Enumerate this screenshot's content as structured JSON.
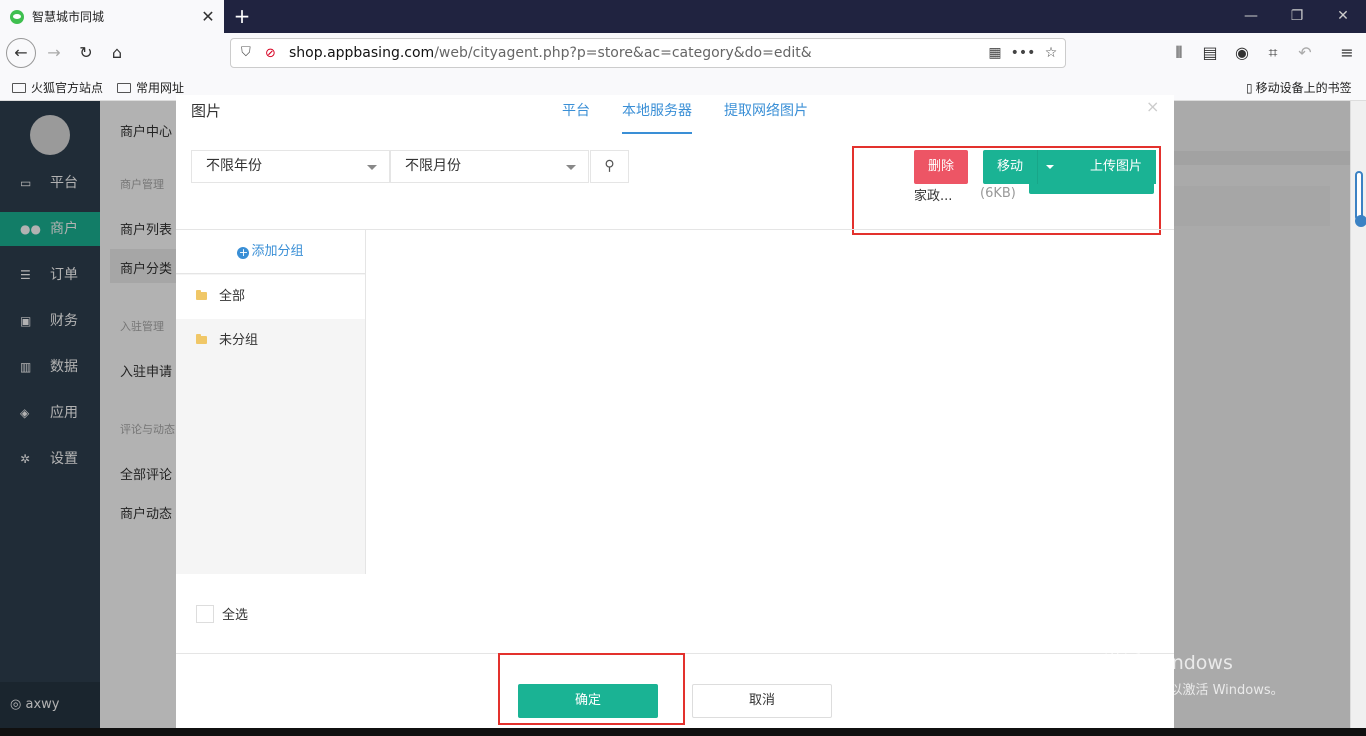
{
  "browser": {
    "tab_title": "智慧城市同城",
    "tab_close": "✕",
    "new_tab": "+",
    "url_domain": "shop.appbasing.com",
    "url_path": "/web/cityagent.php?p=store&ac=category&do=edit&",
    "bookmarks": [
      "火狐官方站点",
      "常用网址"
    ],
    "mobile_bookmarks": "移动设备上的书签"
  },
  "sidebar": {
    "items": [
      {
        "label": "平台",
        "icon": "monitor-icon"
      },
      {
        "label": "商户",
        "icon": "users-icon"
      },
      {
        "label": "订单",
        "icon": "list-icon"
      },
      {
        "label": "财务",
        "icon": "money-icon"
      },
      {
        "label": "数据",
        "icon": "bar-chart-icon"
      },
      {
        "label": "应用",
        "icon": "cubes-icon"
      },
      {
        "label": "设置",
        "icon": "gear-icon"
      }
    ],
    "user": "axwy"
  },
  "subnav": {
    "center": "商户中心",
    "group1": "商户管理",
    "list": "商户列表",
    "category": "商户分类",
    "group2": "入驻管理",
    "apply": "入驻申请",
    "group3": "评论与动态",
    "comments": "全部评论",
    "moments": "商户动态"
  },
  "modal": {
    "title": "图片",
    "tabs": [
      "平台",
      "本地服务器",
      "提取网络图片"
    ],
    "close": "×",
    "year_filter": "不限年份",
    "month_filter": "不限月份",
    "delete_label": "删除",
    "move_label": "移动",
    "upload_label": "上传图片",
    "file_name": "家政...",
    "file_size": "(6KB)",
    "add_group": "添加分组",
    "groups": [
      "全部",
      "未分组"
    ],
    "select_all": "全选",
    "confirm": "确定",
    "cancel": "取消"
  },
  "watermark": {
    "line1": "激活 Windows",
    "line2": "转到“设置”以激活 Windows。"
  },
  "colors": {
    "primary": "#1ab394",
    "danger": "#ed5565",
    "link": "#3a8fd6",
    "sidebar": "#2f4050",
    "highlight": "#e3312d"
  }
}
